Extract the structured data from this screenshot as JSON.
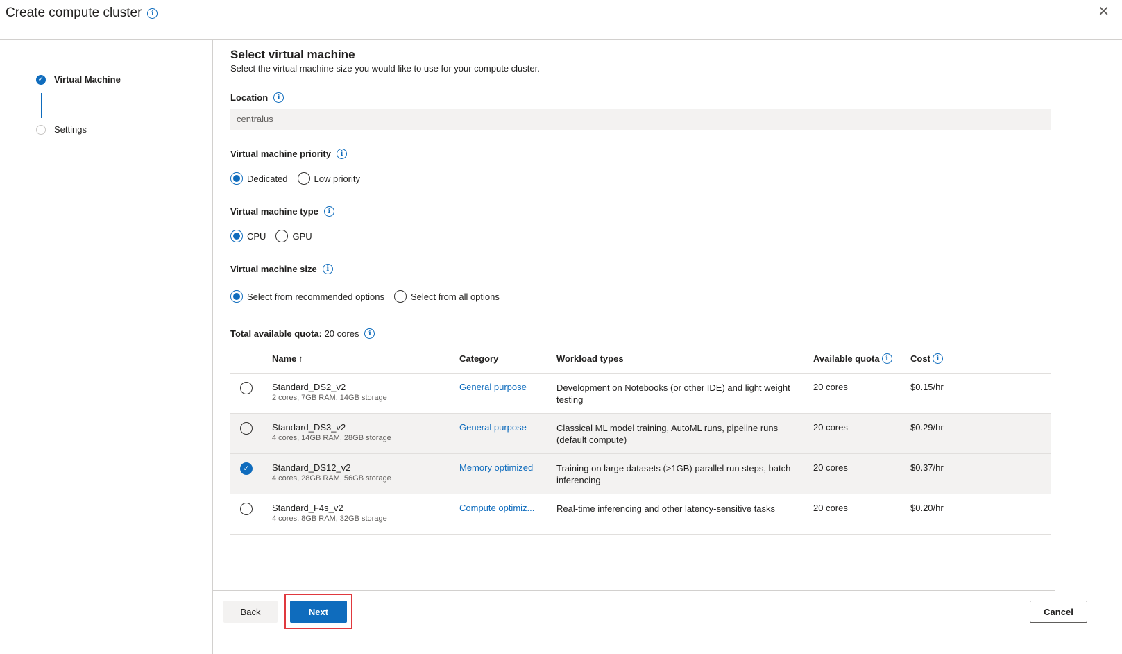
{
  "header": {
    "title": "Create compute cluster",
    "close_label": "✕"
  },
  "steps": [
    {
      "label": "Virtual Machine",
      "status": "done"
    },
    {
      "label": "Settings",
      "status": "pending"
    }
  ],
  "main": {
    "heading": "Select virtual machine",
    "subheading": "Select the virtual machine size you would like to use for your compute cluster.",
    "location": {
      "label": "Location",
      "value": "centralus"
    },
    "priority": {
      "label": "Virtual machine priority",
      "options": [
        "Dedicated",
        "Low priority"
      ],
      "selected": "Dedicated"
    },
    "type": {
      "label": "Virtual machine type",
      "options": [
        "CPU",
        "GPU"
      ],
      "selected": "CPU"
    },
    "size": {
      "label": "Virtual machine size",
      "options": [
        "Select from recommended options",
        "Select from all options"
      ],
      "selected": "Select from recommended options"
    },
    "quota": {
      "label": "Total available quota:",
      "value": "20 cores"
    },
    "table": {
      "headers": {
        "name": "Name",
        "sort_icon": "↑",
        "category": "Category",
        "workload": "Workload types",
        "quota": "Available quota",
        "cost": "Cost"
      },
      "rows": [
        {
          "name": "Standard_DS2_v2",
          "spec": "2 cores, 7GB RAM, 14GB storage",
          "category": "General purpose",
          "workload": "Development on Notebooks (or other IDE) and light weight testing",
          "quota": "20 cores",
          "cost": "$0.15/hr",
          "selected": false
        },
        {
          "name": "Standard_DS3_v2",
          "spec": "4 cores, 14GB RAM, 28GB storage",
          "category": "General purpose",
          "workload": "Classical ML model training, AutoML runs, pipeline runs (default compute)",
          "quota": "20 cores",
          "cost": "$0.29/hr",
          "selected": false
        },
        {
          "name": "Standard_DS12_v2",
          "spec": "4 cores, 28GB RAM, 56GB storage",
          "category": "Memory optimized",
          "workload": "Training on large datasets (>1GB) parallel run steps, batch inferencing",
          "quota": "20 cores",
          "cost": "$0.37/hr",
          "selected": true
        },
        {
          "name": "Standard_F4s_v2",
          "spec": "4 cores, 8GB RAM, 32GB storage",
          "category": "Compute optimiz...",
          "workload": "Real-time inferencing and other latency-sensitive tasks",
          "quota": "20 cores",
          "cost": "$0.20/hr",
          "selected": false
        }
      ]
    }
  },
  "footer": {
    "back": "Back",
    "next": "Next",
    "cancel": "Cancel"
  },
  "colors": {
    "accent": "#0f6cbd",
    "highlight": "#e0393e"
  }
}
